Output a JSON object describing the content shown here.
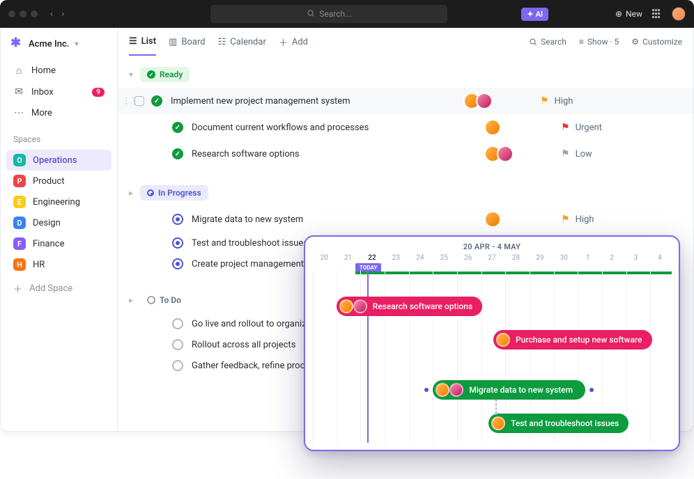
{
  "topbar": {
    "search_placeholder": "Search...",
    "ai_label": "AI",
    "new_label": "New"
  },
  "workspace": {
    "name": "Acme Inc."
  },
  "nav": {
    "home": "Home",
    "inbox": "Inbox",
    "inbox_badge": "9",
    "more": "More"
  },
  "spaces_label": "Spaces",
  "spaces": [
    {
      "key": "O",
      "label": "Operations",
      "color": "#14b8a6",
      "active": true
    },
    {
      "key": "P",
      "label": "Product",
      "color": "#ef4444"
    },
    {
      "key": "E",
      "label": "Engineering",
      "color": "#facc15"
    },
    {
      "key": "D",
      "label": "Design",
      "color": "#3b82f6"
    },
    {
      "key": "F",
      "label": "Finance",
      "color": "#8b5cf6"
    },
    {
      "key": "H",
      "label": "HR",
      "color": "#f97316"
    }
  ],
  "add_space": "Add Space",
  "views": {
    "list": "List",
    "board": "Board",
    "calendar": "Calendar",
    "add": "Add",
    "search": "Search",
    "show": "Show · 5",
    "customize": "Customize"
  },
  "groups": {
    "ready": {
      "label": "Ready",
      "tasks": [
        {
          "title": "Implement new project management system",
          "priority": "High",
          "flag": "high",
          "avatars": 2
        },
        {
          "title": "Document current workflows and processes",
          "priority": "Urgent",
          "flag": "urgent",
          "avatars": 1
        },
        {
          "title": "Research software options",
          "priority": "Low",
          "flag": "low",
          "avatars": 2
        }
      ]
    },
    "in_progress": {
      "label": "In Progress",
      "tasks": [
        {
          "title": "Migrate data to new system",
          "priority": "High",
          "flag": "high",
          "avatars": 1
        },
        {
          "title": "Test and troubleshoot issues"
        },
        {
          "title": "Create project management stand"
        }
      ]
    },
    "todo": {
      "label": "To Do",
      "tasks": [
        {
          "title": "Go live and rollout to organization"
        },
        {
          "title": "Rollout across all projects"
        },
        {
          "title": "Gather feedback, refine process"
        }
      ]
    }
  },
  "timeline": {
    "range": "20 APR - 4 MAY",
    "today_label": "TODAY",
    "dates": [
      "20",
      "21",
      "22",
      "23",
      "24",
      "25",
      "26",
      "27",
      "28",
      "29",
      "30",
      "1",
      "2",
      "3",
      "4"
    ],
    "today_index": 2,
    "bars": [
      {
        "label": "Research software options",
        "color": "pink",
        "start": 1,
        "span": 5.7,
        "avatars": 2
      },
      {
        "label": "Purchase and setup new software",
        "color": "pink",
        "start": 7.5,
        "span": 6.2,
        "avatars": 1
      },
      {
        "label": "Migrate data to new system",
        "color": "green",
        "start": 5,
        "span": 6.3,
        "avatars": 2
      },
      {
        "label": "Test and troubleshoot issues",
        "color": "green",
        "start": 7.3,
        "span": 5.8,
        "avatars": 1
      }
    ]
  }
}
